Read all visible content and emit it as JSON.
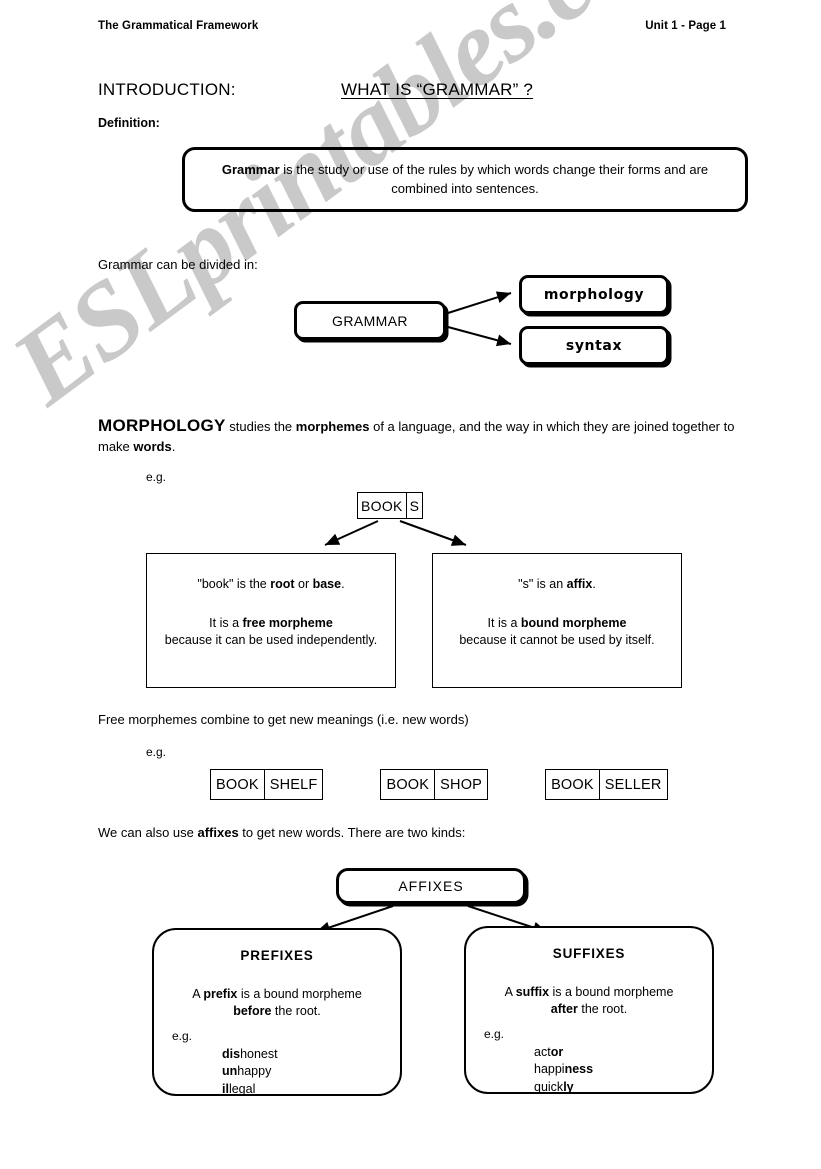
{
  "header": {
    "left": "The Grammatical Framework",
    "right": "Unit 1 - Page 1"
  },
  "intro": {
    "label": "INTRODUCTION:",
    "question": "WHAT IS “GRAMMAR” ?",
    "definition_label": "Definition:"
  },
  "definition_box": {
    "bold_word": "Grammar",
    "rest": " is the study or use of the rules by which words change their forms and are combined into sentences."
  },
  "divided": {
    "line": "Grammar can be divided in:"
  },
  "grammar_diagram": {
    "root": "GRAMMAR",
    "branch_1": "morphology",
    "branch_2": "syntax"
  },
  "morphology_paragraph": {
    "heading": "MORPHOLOGY",
    "t1": " studies the ",
    "b1": "morphemes",
    "t2": " of a language, and the way in which they are joined together to make ",
    "b2": "words",
    "t3": "."
  },
  "eg_label": "e.g.",
  "books_box": {
    "cells": [
      "BOOK",
      "S"
    ]
  },
  "morpheme_boxes": [
    {
      "line1_pre": "\"book\" is the ",
      "line1_b1": "root",
      "line1_mid": " or ",
      "line1_b2": "base",
      "line1_post": ".",
      "line2_pre": "It is a ",
      "line2_b": "free morpheme",
      "line2_rest": "because it can be used independently."
    },
    {
      "line1_pre": "\"s\" is an ",
      "line1_b1": "affix",
      "line1_mid": "",
      "line1_b2": "",
      "line1_post": ".",
      "line2_pre": "It is a ",
      "line2_b": "bound morpheme",
      "line2_rest": "because it cannot be used by itself."
    }
  ],
  "free_morphemes": {
    "line": "Free morphemes combine to get new meanings (i.e. new words)"
  },
  "compound_words": [
    {
      "part1": "BOOK",
      "part2": "SHELF"
    },
    {
      "part1": "BOOK",
      "part2": "SHOP"
    },
    {
      "part1": "BOOK",
      "part2": "SELLER"
    }
  ],
  "affixes_intro": {
    "pre": "We can also use ",
    "bold": "affixes",
    "post": " to get new words. There are two kinds:"
  },
  "affixes_diagram": {
    "root": "AFFIXES",
    "prefixes": {
      "title": "PREFIXES",
      "desc_pre": "A ",
      "desc_b1": "prefix",
      "desc_mid": " is a bound morpheme ",
      "desc_b2": "before",
      "desc_post": " the root.",
      "eg": "e.g.",
      "examples": [
        {
          "bold": "dis",
          "rest": "honest"
        },
        {
          "bold": "un",
          "rest": "happy"
        },
        {
          "bold": "il",
          "rest": "legal"
        }
      ]
    },
    "suffixes": {
      "title": "SUFFIXES",
      "desc_pre": "A ",
      "desc_b1": "suffix",
      "desc_mid": " is a bound morpheme ",
      "desc_b2": "after",
      "desc_post": " the root.",
      "eg": "e.g.",
      "examples": [
        {
          "rest": "act",
          "bold": "or"
        },
        {
          "rest": "happi",
          "bold": "ness"
        },
        {
          "rest": "quick",
          "bold": "ly"
        }
      ]
    }
  },
  "watermark": {
    "text": "ESLprintables.com",
    "color": "#c9c9c9"
  }
}
